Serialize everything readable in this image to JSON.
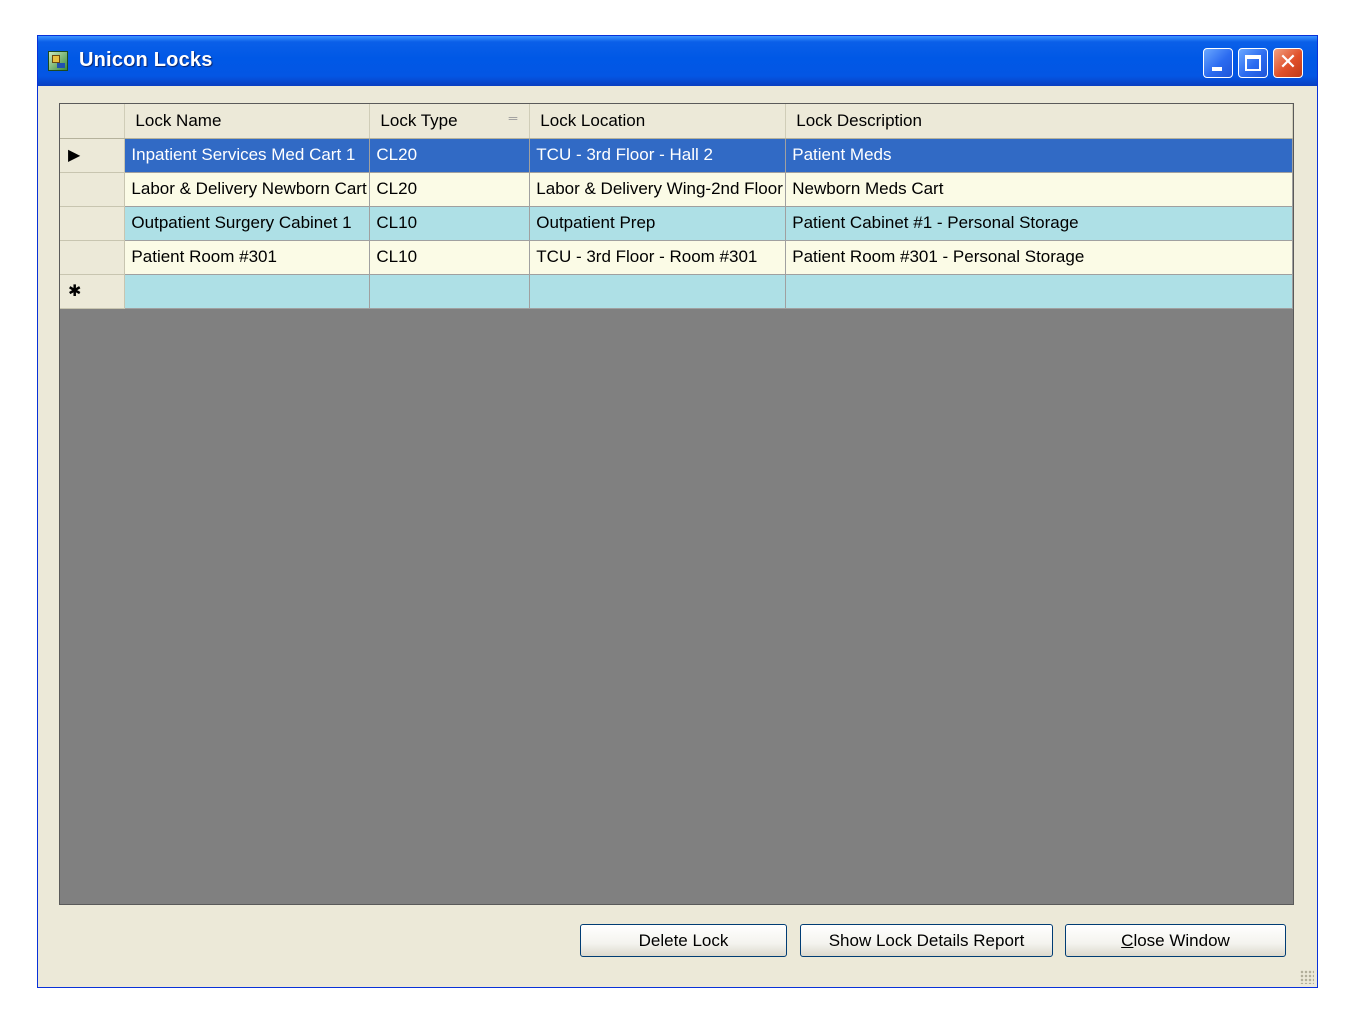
{
  "window": {
    "title": "Unicon Locks",
    "controls": {
      "minimize": "minimize",
      "maximize": "maximize",
      "close": "✕"
    }
  },
  "grid": {
    "columns": [
      "Lock Name",
      "Lock Type",
      "Lock Location",
      "Lock Description"
    ],
    "sort_glyph": "═",
    "current_row_marker": "▶",
    "new_row_marker": "✱",
    "rows": [
      {
        "name": "Inpatient Services Med Cart 1",
        "type": "CL20",
        "location": "TCU - 3rd Floor - Hall 2",
        "description": "Patient Meds"
      },
      {
        "name": "Labor & Delivery Newborn Cart",
        "type": "CL20",
        "location": "Labor & Delivery Wing-2nd Floor",
        "description": "Newborn Meds Cart"
      },
      {
        "name": "Outpatient Surgery Cabinet 1",
        "type": "CL10",
        "location": "Outpatient Prep",
        "description": "Patient Cabinet #1 - Personal Storage"
      },
      {
        "name": "Patient Room #301",
        "type": "CL10",
        "location": "TCU - 3rd Floor - Room #301",
        "description": "Patient Room #301 - Personal Storage"
      }
    ]
  },
  "buttons": {
    "delete": "Delete Lock",
    "report": "Show Lock Details Report",
    "close_mnemonic": "C",
    "close_rest": "lose Window"
  },
  "colors": {
    "selection": "#316ac5",
    "row_alt_light": "#fbfbe6",
    "row_alt_cyan": "#aee0e6",
    "grid_background": "#808080",
    "titlebar": "#0058e6"
  }
}
